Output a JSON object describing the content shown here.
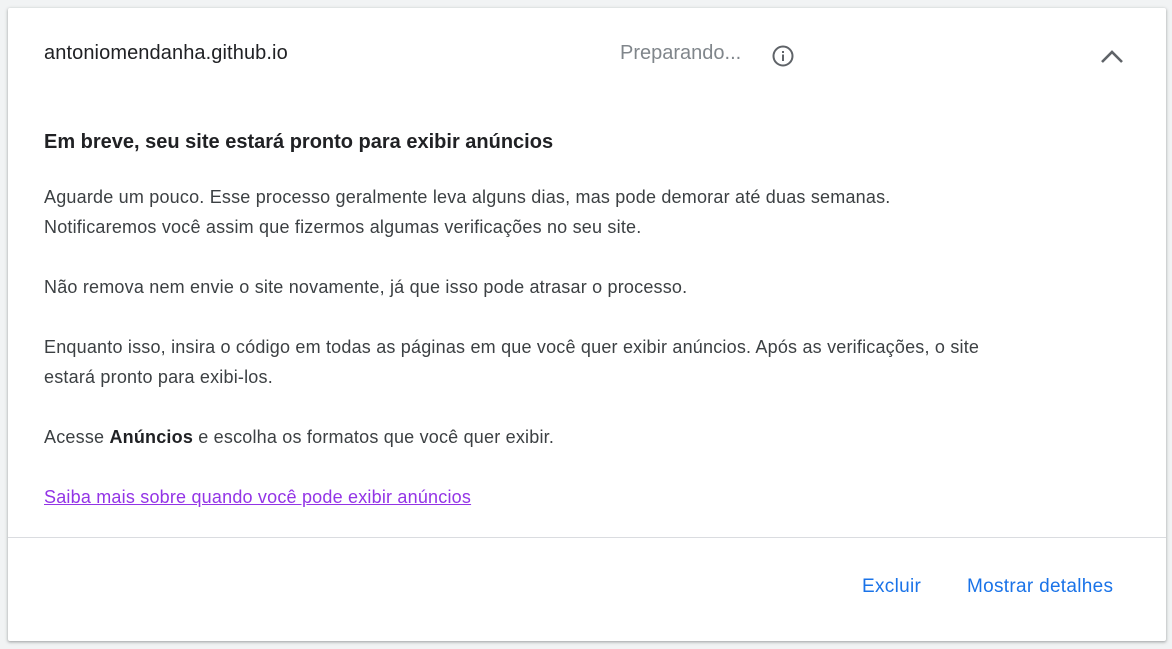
{
  "header": {
    "site_name": "antoniomendanha.github.io",
    "status": "Preparando...",
    "info_icon": "info-icon",
    "collapse_icon": "chevron-up-icon"
  },
  "body": {
    "title": "Em breve, seu site estará pronto para exibir anúncios",
    "paragraphs": [
      "Aguarde um pouco. Esse processo geralmente leva alguns dias, mas pode demorar até duas semanas. Notificaremos você assim que fizermos algumas verificações no seu site.",
      "Não remova nem envie o site novamente, já que isso pode atrasar o processo.",
      "Enquanto isso, insira o código em todas as páginas em que você quer exibir anúncios. Após as verificações, o site estará pronto para exibi-los."
    ],
    "ads_sentence": {
      "prefix": "Acesse ",
      "bold": "Anúncios",
      "suffix": " e escolha os formatos que você quer exibir."
    },
    "learn_more_link": "Saiba mais sobre quando você pode exibir anúncios"
  },
  "footer": {
    "delete_label": "Excluir",
    "details_label": "Mostrar detalhes"
  },
  "colors": {
    "accent": "#1a73e8",
    "link_visited": "#9334e6",
    "status_gray": "#80868b"
  }
}
